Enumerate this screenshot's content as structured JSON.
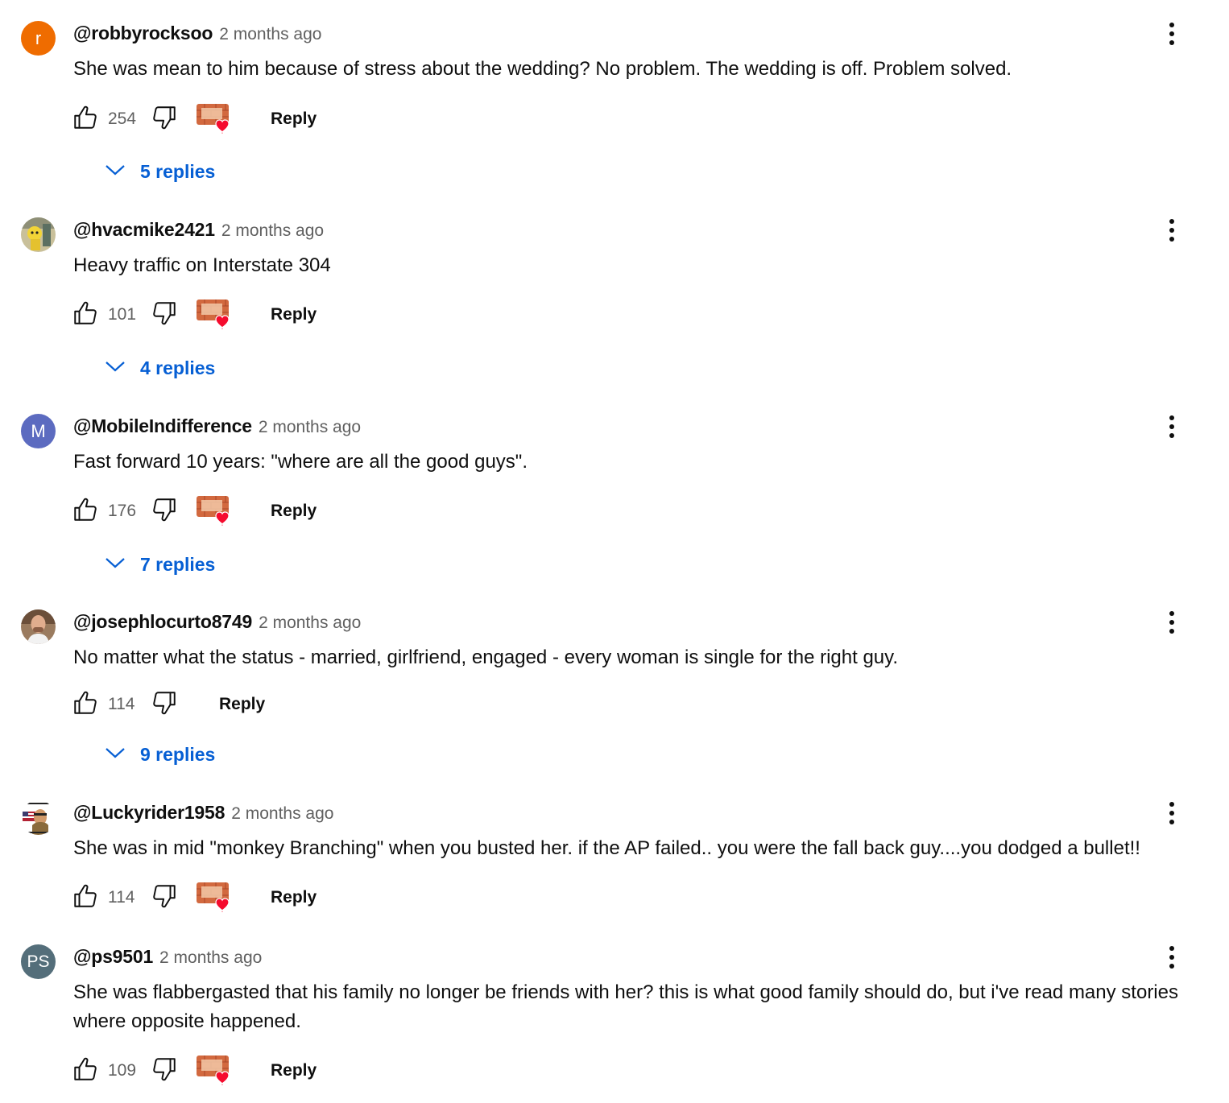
{
  "colors": {
    "link_blue": "#065fd4",
    "meta_gray": "#606060",
    "heart_red": "#f50b2e",
    "brick_orange": "#d2693f"
  },
  "badge": {
    "text": "HIT THE BRICK"
  },
  "comments": [
    {
      "author": "@robbyrocksoo",
      "time": "2 months ago",
      "text": "She was mean to him because of stress about the wedding? No problem. The wedding is off. Problem solved.",
      "likes": "254",
      "reply_label": "Reply",
      "replies_label": "5 replies",
      "avatar": {
        "type": "initial",
        "initial": "r",
        "color": "#ef6c00"
      },
      "creator_heart": true
    },
    {
      "author": "@hvacmike2421",
      "time": "2 months ago",
      "text": "Heavy traffic on Interstate 304",
      "likes": "101",
      "reply_label": "Reply",
      "replies_label": "4 replies",
      "avatar": {
        "type": "image",
        "icon": "yellow-cartoon-avatar"
      },
      "creator_heart": true
    },
    {
      "author": "@MobileIndifference",
      "time": "2 months ago",
      "text": "Fast forward 10 years: \"where are all the good guys\".",
      "likes": "176",
      "reply_label": "Reply",
      "replies_label": "7 replies",
      "avatar": {
        "type": "initial",
        "initial": "M",
        "color": "#5c6bc0"
      },
      "creator_heart": true
    },
    {
      "author": "@josephlocurto8749",
      "time": "2 months ago",
      "text": "No matter what the status - married, girlfriend, engaged - every woman is single for the right guy.",
      "likes": "114",
      "reply_label": "Reply",
      "replies_label": "9 replies",
      "avatar": {
        "type": "image",
        "icon": "man-photo-avatar"
      },
      "creator_heart": false
    },
    {
      "author": "@Luckyrider1958",
      "time": "2 months ago",
      "text": "She was in mid \"monkey Branching\" when you busted her. if the AP failed.. you were the fall back guy....you dodged a bullet!!",
      "likes": "114",
      "reply_label": "Reply",
      "replies_label": "",
      "avatar": {
        "type": "image",
        "icon": "flag-biker-avatar"
      },
      "creator_heart": true
    },
    {
      "author": "@ps9501",
      "time": "2 months ago",
      "text": "She was flabbergasted that his family no longer be friends with her? this is what good family should do, but i've read many stories where opposite happened.",
      "likes": "109",
      "reply_label": "Reply",
      "replies_label": "",
      "avatar": {
        "type": "initial",
        "initial": "PS",
        "color": "#546e7a"
      },
      "creator_heart": true
    }
  ]
}
